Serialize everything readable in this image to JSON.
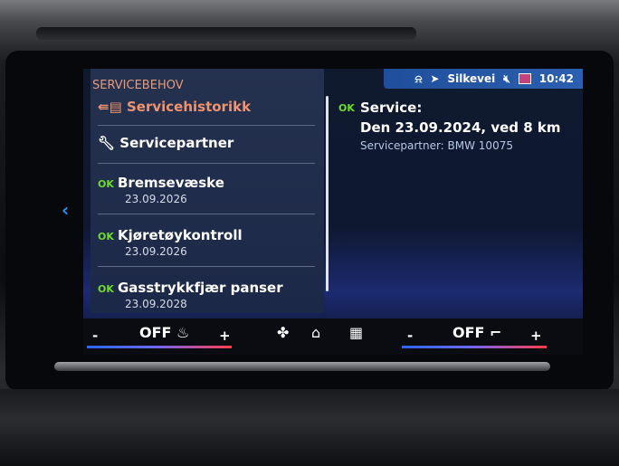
{
  "screen": {
    "status_bar": {
      "nav_icon": "navigation-arrow-icon",
      "destination": "Silkevei",
      "mute_icon": "speaker-muted-icon",
      "time": "10:42"
    },
    "left_panel": {
      "title": "SERVICEBEHOV",
      "items": [
        {
          "icon": "service-history-icon",
          "label": "Servicehistorikk",
          "status": "",
          "date": ""
        },
        {
          "icon": "wrench-icon",
          "label": "Servicepartner",
          "status": "",
          "date": ""
        },
        {
          "icon": "",
          "label": "Bremsevæske",
          "status": "OK",
          "date": "23.09.2026"
        },
        {
          "icon": "",
          "label": "Kjøretøykontroll",
          "status": "OK",
          "date": "23.09.2026"
        },
        {
          "icon": "",
          "label": "Gasstrykkfjær panser",
          "status": "OK",
          "date": "23.09.2028"
        }
      ]
    },
    "detail": {
      "status": "OK",
      "title": "Service:",
      "date_line": "Den 23.09.2024, ved 8 km",
      "partner": "Servicepartner: BMW 10075"
    },
    "bottom_bar": {
      "left_minus": "-",
      "left_value": "OFF",
      "left_plus": "+",
      "right_minus": "-",
      "right_value": "OFF",
      "right_plus": "+"
    }
  },
  "colors": {
    "accent_orange": "#f0936f",
    "ok_green": "#6ddb2f",
    "status_blue": "#2b5fb0"
  }
}
